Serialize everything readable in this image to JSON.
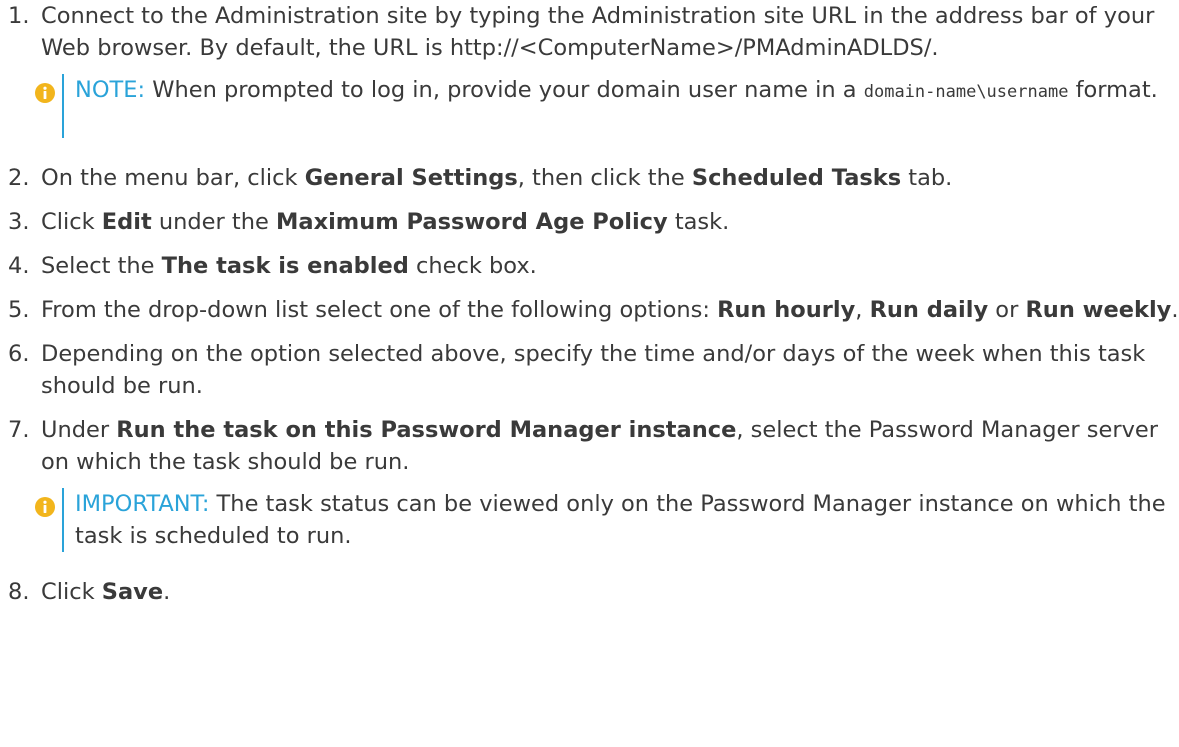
{
  "steps": [
    {
      "num": "1.",
      "parts": [
        {
          "t": "Connect to the Administration site by typing the Administration site URL in the address bar of your Web browser. By default, the URL is http://<ComputerName>/PMAdminADLDS/."
        }
      ],
      "note": {
        "label": "NOTE:",
        "parts": [
          {
            "t": " When prompted to log in, provide your domain user name in a "
          },
          {
            "t": "domain-name\\username",
            "code": true
          },
          {
            "t": " format."
          }
        ]
      }
    },
    {
      "num": "2.",
      "parts": [
        {
          "t": "On the menu bar, click "
        },
        {
          "t": "General Settings",
          "b": true
        },
        {
          "t": ", then click the "
        },
        {
          "t": "Scheduled Tasks",
          "b": true
        },
        {
          "t": " tab."
        }
      ]
    },
    {
      "num": "3.",
      "parts": [
        {
          "t": "Click "
        },
        {
          "t": "Edit",
          "b": true
        },
        {
          "t": " under the "
        },
        {
          "t": "Maximum Password Age Policy",
          "b": true
        },
        {
          "t": " task."
        }
      ]
    },
    {
      "num": "4.",
      "parts": [
        {
          "t": "Select the "
        },
        {
          "t": "The task is enabled",
          "b": true
        },
        {
          "t": " check box."
        }
      ]
    },
    {
      "num": "5.",
      "parts": [
        {
          "t": "From the drop-down list select one of the following options: "
        },
        {
          "t": "Run hourly",
          "b": true
        },
        {
          "t": ", "
        },
        {
          "t": "Run daily",
          "b": true
        },
        {
          "t": " or "
        },
        {
          "t": "Run weekly",
          "b": true
        },
        {
          "t": "."
        }
      ]
    },
    {
      "num": "6.",
      "parts": [
        {
          "t": "Depending on the option selected above, specify the time and/or days of the week when this task should be run."
        }
      ]
    },
    {
      "num": "7.",
      "parts": [
        {
          "t": "Under "
        },
        {
          "t": "Run the task on this Password Manager instance",
          "b": true
        },
        {
          "t": ", select the Password Manager server on which the task should be run."
        }
      ],
      "note": {
        "label": "IMPORTANT:",
        "parts": [
          {
            "t": " The task status can be viewed only on the Password Manager instance on which the task is scheduled to run."
          }
        ]
      }
    },
    {
      "num": "8.",
      "parts": [
        {
          "t": "Click "
        },
        {
          "t": "Save",
          "b": true
        },
        {
          "t": "."
        }
      ]
    }
  ],
  "colors": {
    "text": "#3a3a3a",
    "accent": "#2aa3d9"
  },
  "icons": {
    "note": "info-icon"
  }
}
